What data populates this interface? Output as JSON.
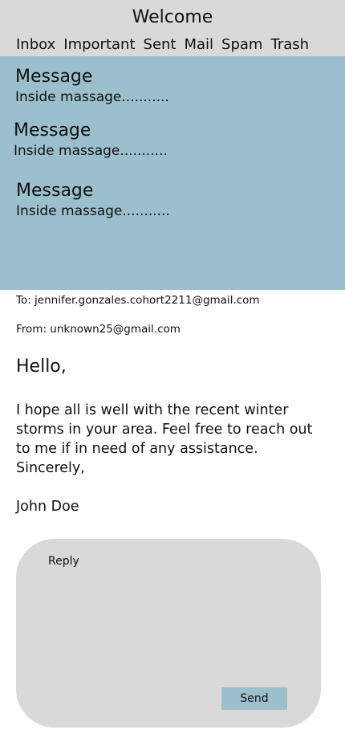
{
  "header": {
    "title": "Welcome",
    "nav": [
      "Inbox",
      "Important",
      "Sent",
      "Mail",
      "Spam",
      "Trash"
    ]
  },
  "messages": [
    {
      "subject": "Message",
      "preview": "Inside massage..........."
    },
    {
      "subject": "Message",
      "preview": "Inside massage..........."
    },
    {
      "subject": "Message",
      "preview": "Inside massage..........."
    }
  ],
  "email": {
    "to": "To: jennifer.gonzales.cohort2211@gmail.com",
    "from": "From: unknown25@gmail.com",
    "greeting": "Hello,",
    "body": "I hope all is well with the recent winter storms in your area. Feel free to reach out to me if in need of any assistance.",
    "signoff": "Sincerely,",
    "signature": "John Doe"
  },
  "reply": {
    "label": "Reply",
    "send_label": "Send"
  },
  "colors": {
    "header_bg": "#d9d9d9",
    "list_bg": "#9cbfce",
    "reply_bg": "#d9d9d9",
    "send_bg": "#9cbfce"
  }
}
